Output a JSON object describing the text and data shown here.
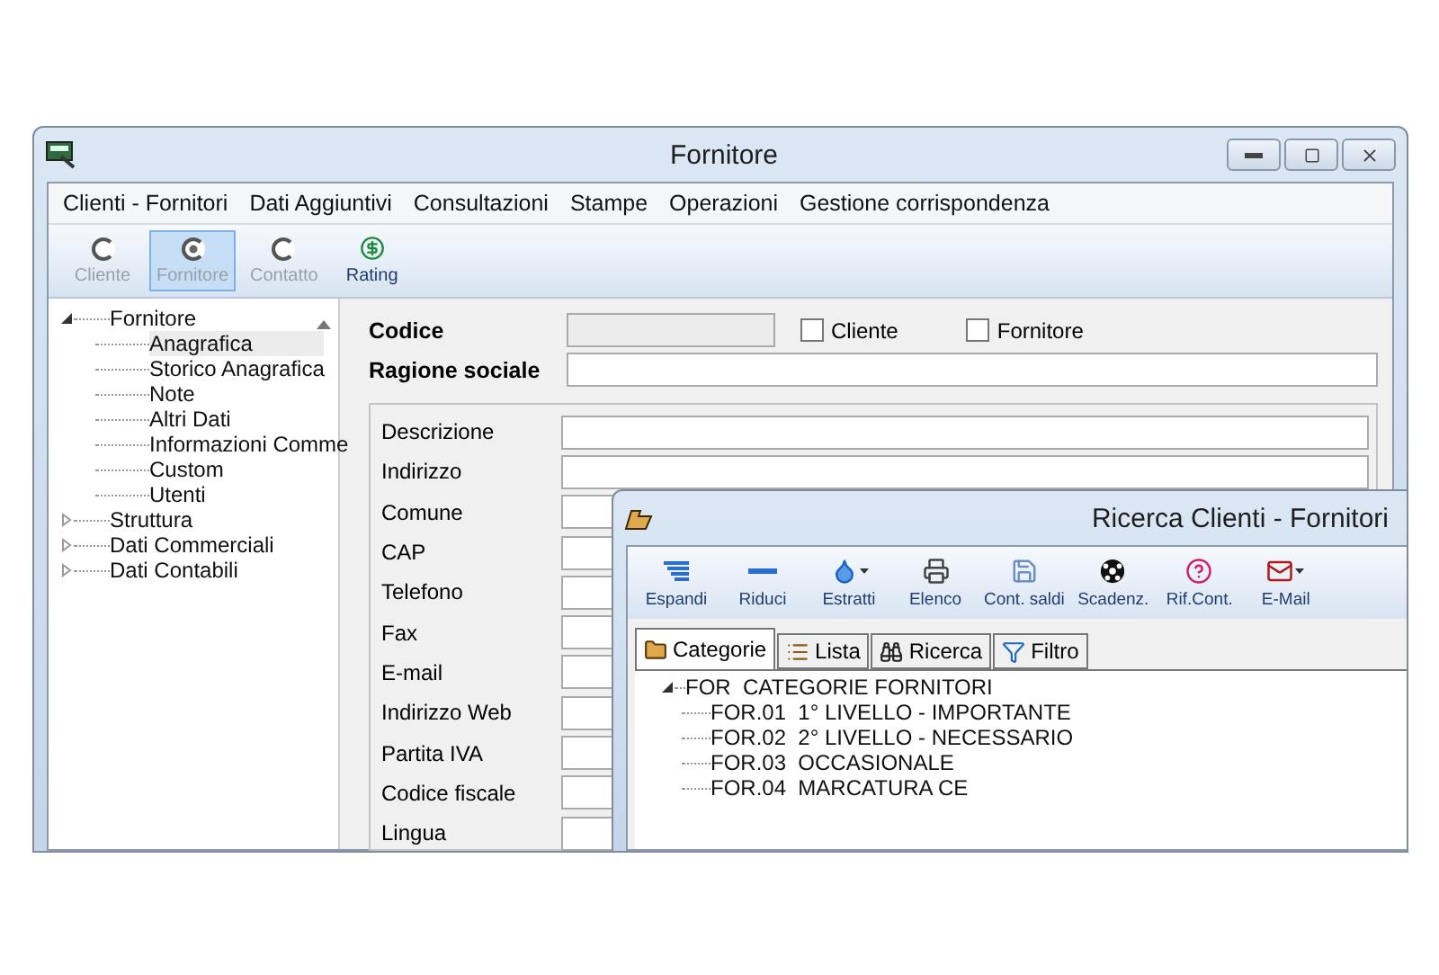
{
  "window": {
    "title": "Fornitore"
  },
  "menu": [
    "Clienti - Fornitori",
    "Dati Aggiuntivi",
    "Consultazioni",
    "Stampe",
    "Operazioni",
    "Gestione corrispondenza"
  ],
  "toolbar": [
    {
      "label": "Cliente",
      "kind": "radio",
      "selected": false,
      "disabled": true
    },
    {
      "label": "Fornitore",
      "kind": "radio",
      "selected": true,
      "disabled": true
    },
    {
      "label": "Contatto",
      "kind": "radio",
      "selected": false,
      "disabled": true
    },
    {
      "label": "Rating",
      "kind": "button",
      "selected": false,
      "disabled": false
    }
  ],
  "tree": [
    {
      "label": "Fornitore",
      "expanded": true,
      "selected": false,
      "children": [
        {
          "label": "Anagrafica",
          "selected": true
        },
        {
          "label": "Storico Anagrafica",
          "selected": false
        },
        {
          "label": "Note",
          "selected": false
        },
        {
          "label": "Altri Dati",
          "selected": false
        },
        {
          "label": "Informazioni Comme",
          "selected": false
        },
        {
          "label": "Custom",
          "selected": false
        },
        {
          "label": "Utenti",
          "selected": false
        }
      ]
    },
    {
      "label": "Struttura",
      "expanded": false,
      "selected": false
    },
    {
      "label": "Dati Commerciali",
      "expanded": false,
      "selected": false
    },
    {
      "label": "Dati Contabili",
      "expanded": false,
      "selected": false
    }
  ],
  "form": {
    "code": {
      "label": "Codice",
      "disabled": true
    },
    "checkboxes": [
      {
        "label": "Cliente",
        "checked": false
      },
      {
        "label": "Fornitore",
        "checked": false
      }
    ],
    "name": {
      "label": "Ragione sociale"
    },
    "fields": [
      "Descrizione",
      "Indirizzo",
      "Comune",
      "CAP",
      "Telefono",
      "Fax",
      "E-mail",
      "Indirizzo Web",
      "Partita IVA",
      "Codice fiscale",
      "Lingua"
    ]
  },
  "dialog": {
    "title": "Ricerca Clienti - Fornitori",
    "toolbar": [
      {
        "label": "Espandi",
        "kind": "expand",
        "dropdown": false
      },
      {
        "label": "Riduci",
        "kind": "collapse",
        "dropdown": false
      },
      {
        "label": "Estratti",
        "kind": "drop",
        "dropdown": true
      },
      {
        "label": "Elenco",
        "kind": "print",
        "dropdown": false
      },
      {
        "label": "Cont. saldi",
        "kind": "disk",
        "dropdown": false
      },
      {
        "label": "Scadenz.",
        "kind": "ball",
        "dropdown": false
      },
      {
        "label": "Rif.Cont.",
        "kind": "help",
        "dropdown": false
      },
      {
        "label": "E-Mail",
        "kind": "mail",
        "dropdown": true
      }
    ],
    "tabs": [
      {
        "label": "Categorie",
        "kind": "categories",
        "selected": true
      },
      {
        "label": "Lista",
        "kind": "list",
        "selected": false
      },
      {
        "label": "Ricerca",
        "kind": "search",
        "selected": false
      },
      {
        "label": "Filtro",
        "kind": "filter",
        "selected": false
      }
    ],
    "tree": {
      "label": "FOR  CATEGORIE FORNITORI",
      "expanded": true,
      "children": [
        {
          "label": "FOR.01  1° LIVELLO - IMPORTANTE"
        },
        {
          "label": "FOR.02  2° LIVELLO - NECESSARIO"
        },
        {
          "label": "FOR.03  OCCASIONALE"
        },
        {
          "label": "FOR.04  MARCATURA CE"
        }
      ]
    }
  }
}
